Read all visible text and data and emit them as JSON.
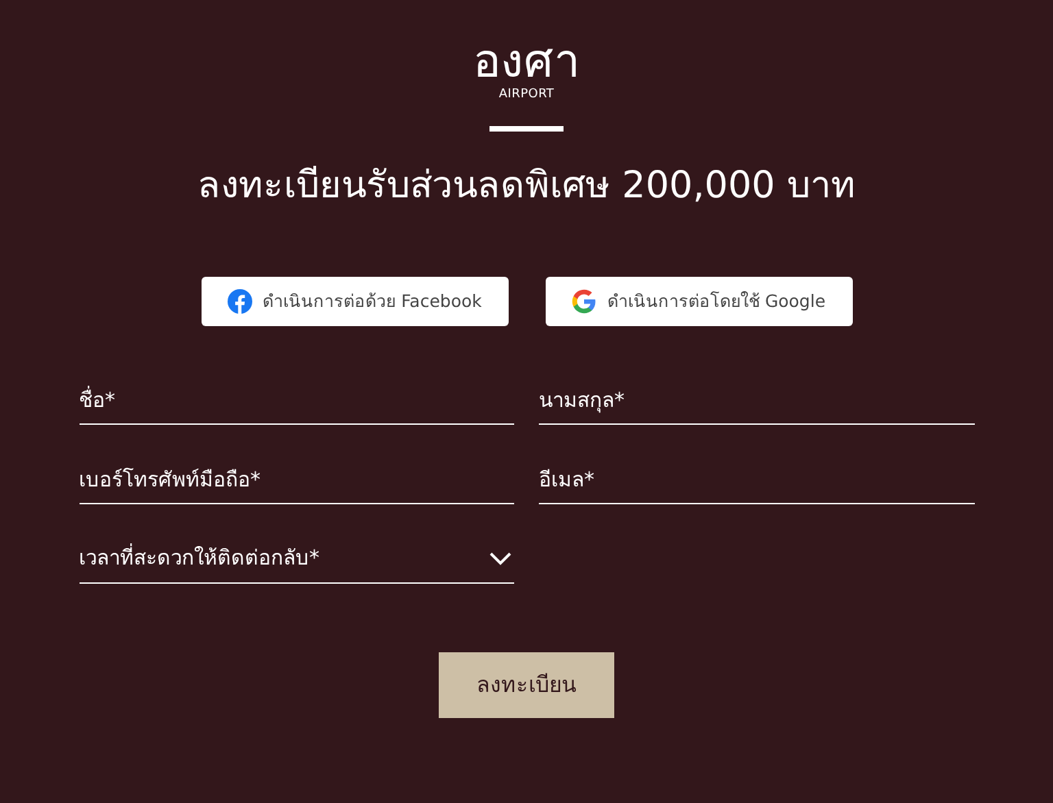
{
  "logo": {
    "wordmark": "องศา",
    "subtitle": "AIRPORT"
  },
  "heading": "ลงทะเบียนรับส่วนลดพิเศษ 200,000 บาท",
  "social_buttons": [
    {
      "kind": "facebook",
      "label": "ดำเนินการต่อด้วย Facebook"
    },
    {
      "kind": "google",
      "label": "ดำเนินการต่อโดยใช้ Google"
    }
  ],
  "fields": [
    {
      "kind": "text",
      "placeholder": "ชื่อ*"
    },
    {
      "kind": "text",
      "placeholder": "นามสกุล*"
    },
    {
      "kind": "text",
      "placeholder": "เบอร์โทรศัพท์มือถือ*"
    },
    {
      "kind": "text",
      "placeholder": "อีเมล*"
    },
    {
      "kind": "dropdown",
      "placeholder": "เวลาที่สะดวกให้ติดต่อกลับ*"
    }
  ],
  "submit_button": "ลงทะเบียน"
}
